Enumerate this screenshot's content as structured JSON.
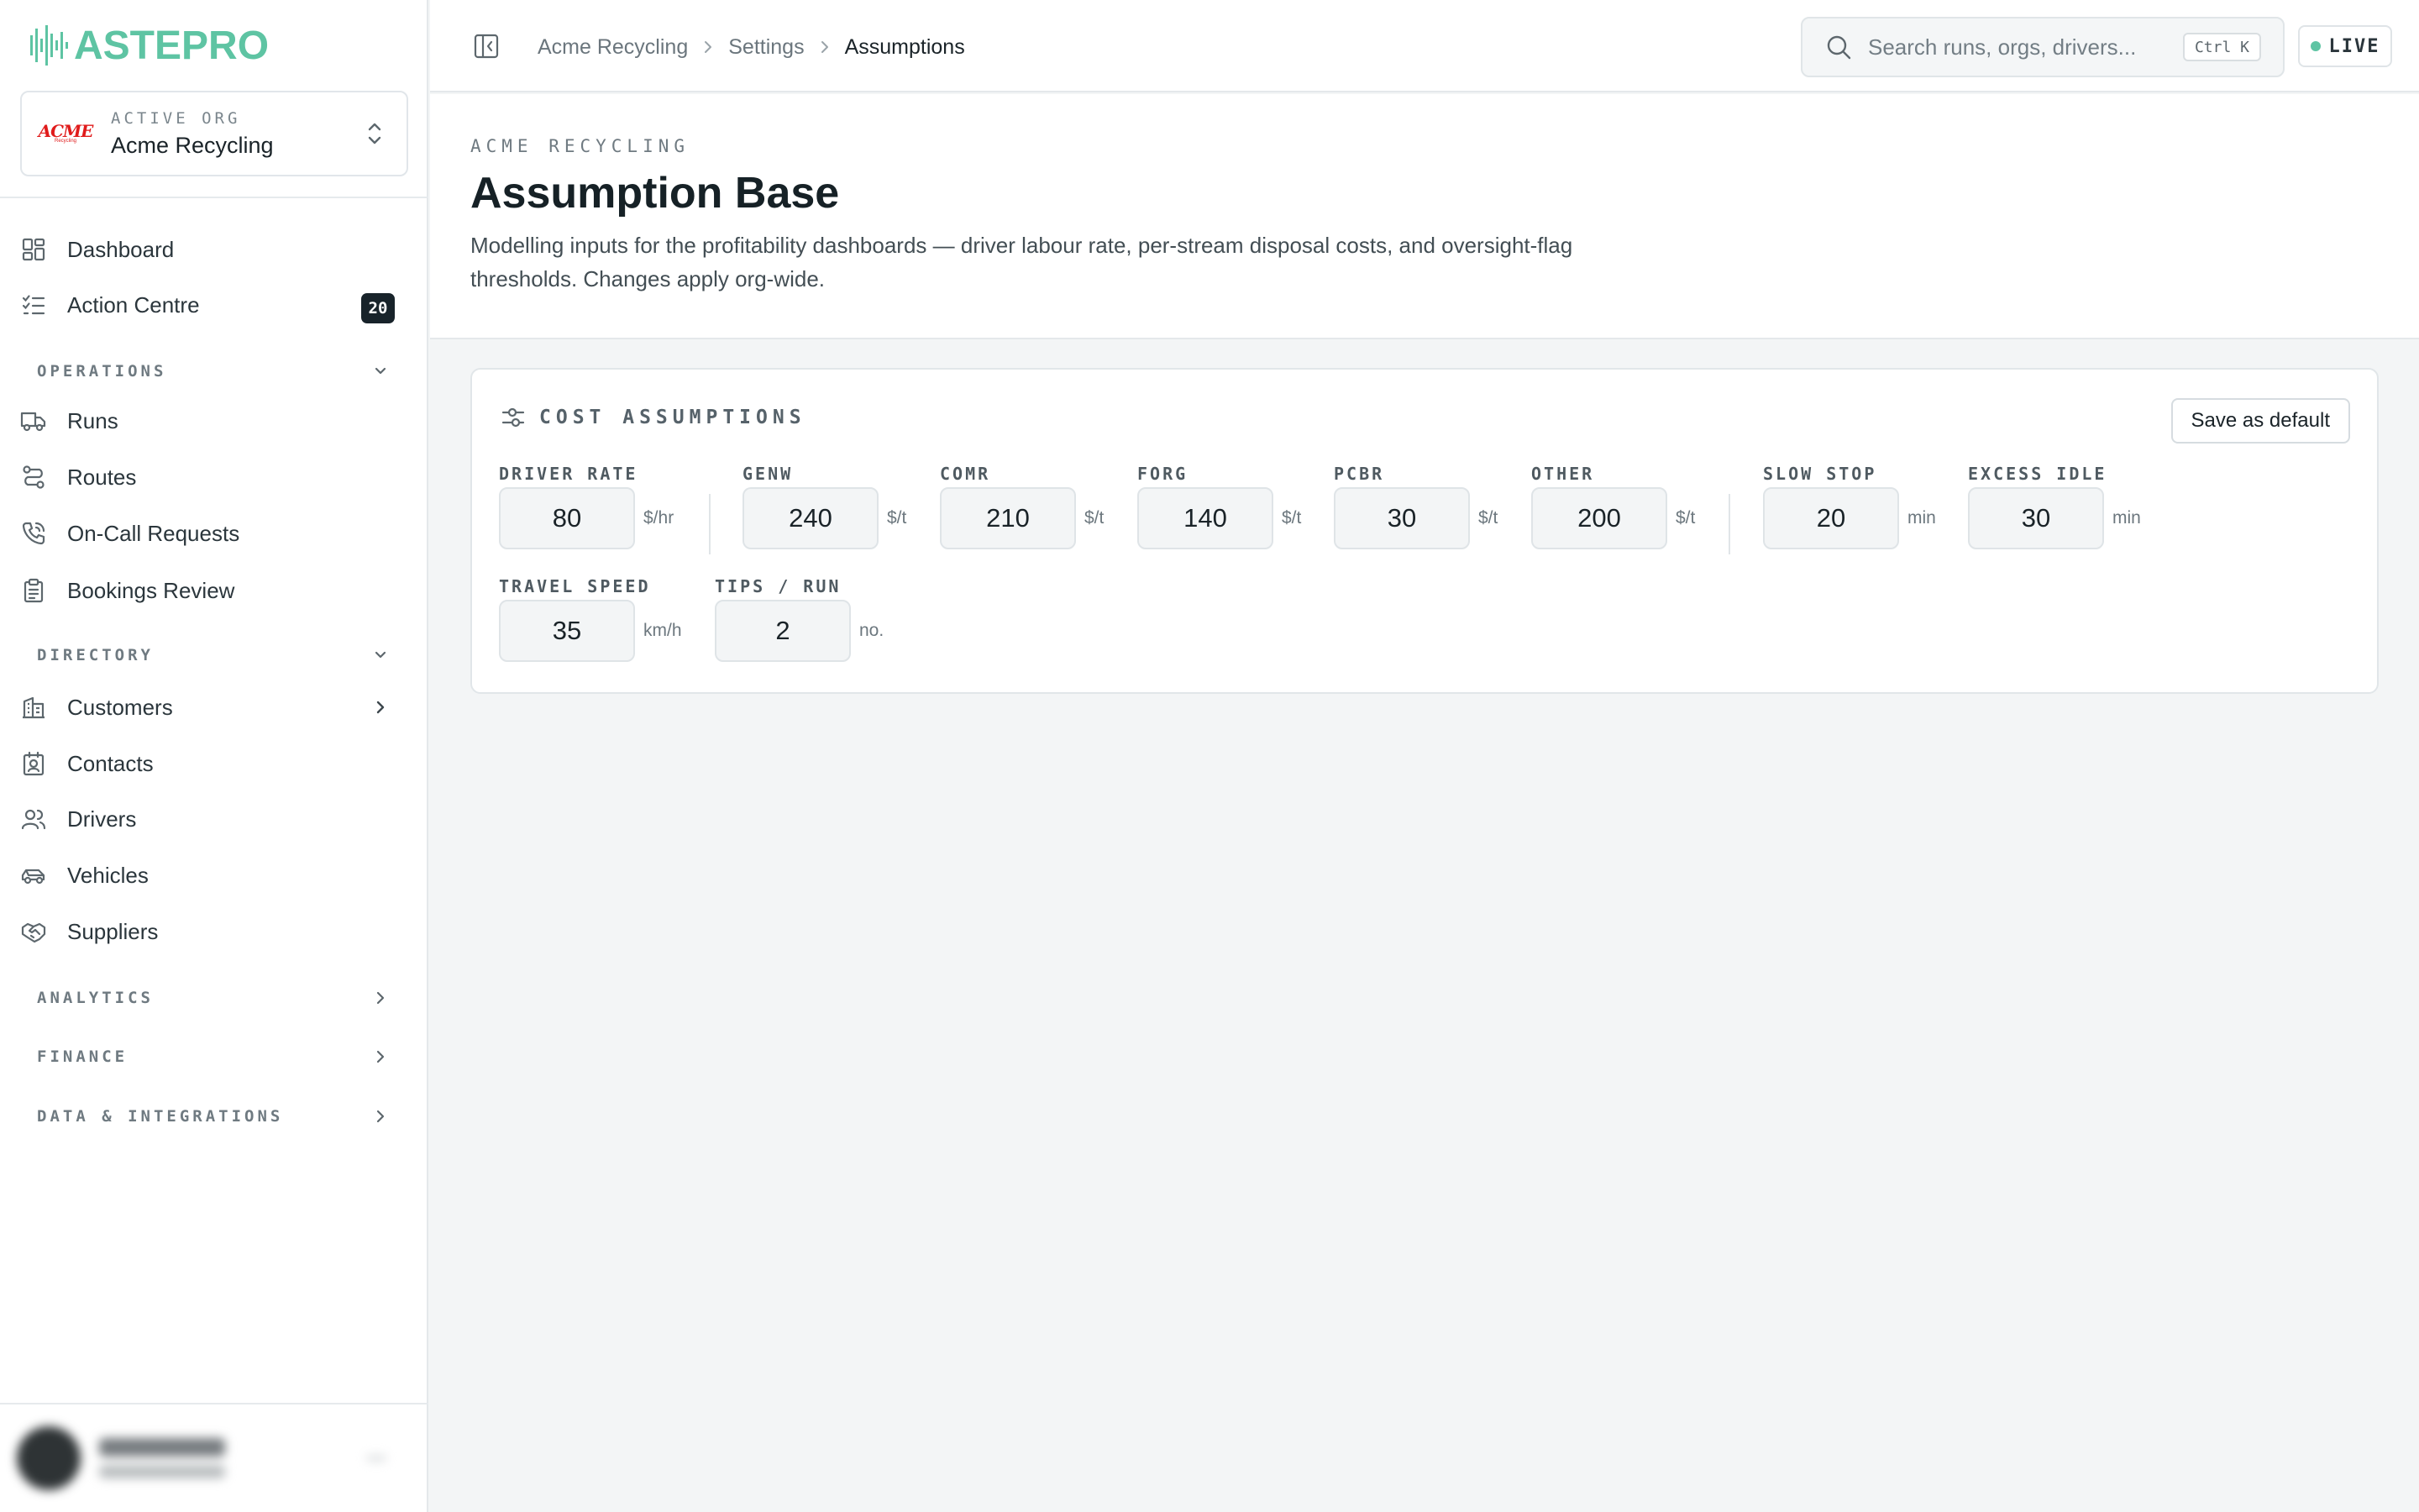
{
  "brand": {
    "name": "ASTEPRO",
    "accent": "#5ec4a3"
  },
  "org": {
    "caption": "ACTIVE ORG",
    "name": "Acme Recycling",
    "logo_text": "ACME",
    "logo_sub": "Recycling"
  },
  "nav": {
    "dashboard": "Dashboard",
    "action_centre": "Action Centre",
    "action_centre_badge": "20",
    "operations": {
      "title": "OPERATIONS",
      "items": [
        "Runs",
        "Routes",
        "On-Call Requests",
        "Bookings Review"
      ]
    },
    "directory": {
      "title": "DIRECTORY",
      "items": [
        "Customers",
        "Contacts",
        "Drivers",
        "Vehicles",
        "Suppliers"
      ]
    },
    "analytics": "ANALYTICS",
    "finance": "FINANCE",
    "data_integrations": "DATA & INTEGRATIONS"
  },
  "breadcrumb": [
    "Acme Recycling",
    "Settings",
    "Assumptions"
  ],
  "search": {
    "placeholder": "Search runs, orgs, drivers...",
    "shortcut": "Ctrl K"
  },
  "status": {
    "label": "LIVE",
    "color": "#5ec4a3"
  },
  "page": {
    "eyebrow": "ACME RECYCLING",
    "title": "Assumption Base",
    "description": "Modelling inputs for the profitability dashboards — driver labour rate, per-stream disposal costs, and oversight-flag thresholds. Changes apply org-wide."
  },
  "card": {
    "title": "COST ASSUMPTIONS",
    "save_label": "Save as default",
    "fields": [
      {
        "label": "DRIVER RATE",
        "value": "80",
        "unit": "$/hr"
      },
      {
        "label": "GENW",
        "value": "240",
        "unit": "$/t"
      },
      {
        "label": "COMR",
        "value": "210",
        "unit": "$/t"
      },
      {
        "label": "FORG",
        "value": "140",
        "unit": "$/t"
      },
      {
        "label": "PCBR",
        "value": "30",
        "unit": "$/t"
      },
      {
        "label": "OTHER",
        "value": "200",
        "unit": "$/t"
      },
      {
        "label": "SLOW STOP",
        "value": "20",
        "unit": "min"
      },
      {
        "label": "EXCESS IDLE",
        "value": "30",
        "unit": "min"
      },
      {
        "label": "TRAVEL SPEED",
        "value": "35",
        "unit": "km/h"
      },
      {
        "label": "TIPS / RUN",
        "value": "2",
        "unit": "no."
      }
    ]
  }
}
